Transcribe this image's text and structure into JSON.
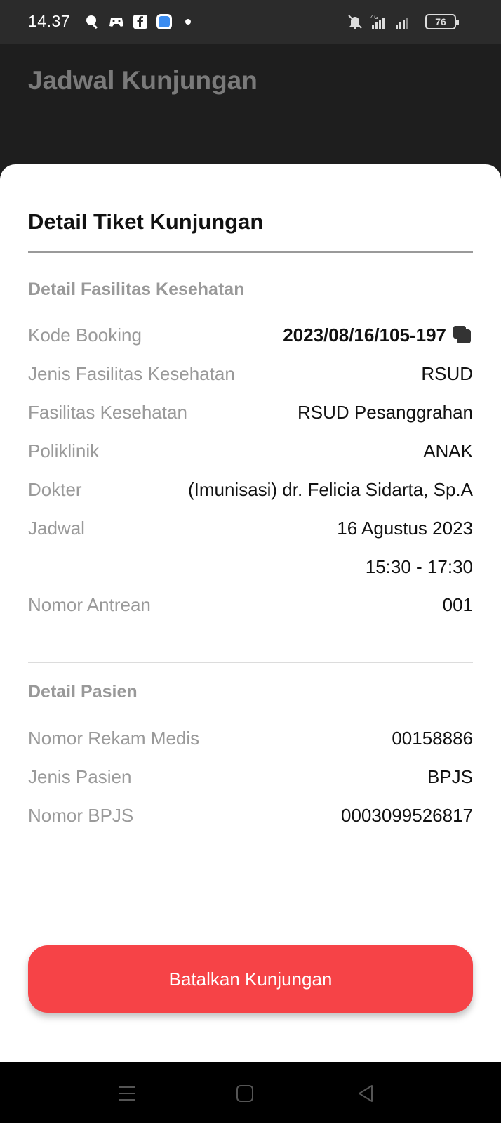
{
  "status_bar": {
    "time": "14.37",
    "network": "4G",
    "battery": "76",
    "left_icons": [
      "search-icon",
      "gamepad-icon",
      "facebook-icon",
      "app-icon",
      "dot-icon"
    ],
    "right_icons": [
      "mute-icon",
      "signal-4g-icon",
      "signal-icon",
      "battery-icon"
    ]
  },
  "header": {
    "title": "Jadwal Kunjungan"
  },
  "sheet": {
    "title": "Detail Tiket Kunjungan",
    "facility_section": {
      "title": "Detail Fasilitas Kesehatan",
      "rows": [
        {
          "label": "Kode Booking",
          "value": "2023/08/16/105-197"
        },
        {
          "label": "Jenis Fasilitas Kesehatan",
          "value": "RSUD"
        },
        {
          "label": "Fasilitas Kesehatan",
          "value": "RSUD Pesanggrahan"
        },
        {
          "label": "Poliklinik",
          "value": "ANAK"
        },
        {
          "label": "Dokter",
          "value": "(Imunisasi) dr. Felicia Sidarta, Sp.A"
        },
        {
          "label": "Jadwal",
          "value": "16 Agustus 2023"
        },
        {
          "label": "",
          "value": "15:30 - 17:30"
        },
        {
          "label": "Nomor Antrean",
          "value": "001"
        }
      ]
    },
    "patient_section": {
      "title": "Detail Pasien",
      "rows": [
        {
          "label": "Nomor Rekam Medis",
          "value": "00158886"
        },
        {
          "label": "Jenis Pasien",
          "value": "BPJS"
        },
        {
          "label": "Nomor BPJS",
          "value": "0003099526817"
        }
      ]
    },
    "cancel_button": "Batalkan Kunjungan"
  },
  "nav_bar": {
    "icons": [
      "menu-icon",
      "home-icon",
      "back-icon"
    ]
  },
  "colors": {
    "accent": "#f64347",
    "header_bg": "#1e1e1e"
  }
}
